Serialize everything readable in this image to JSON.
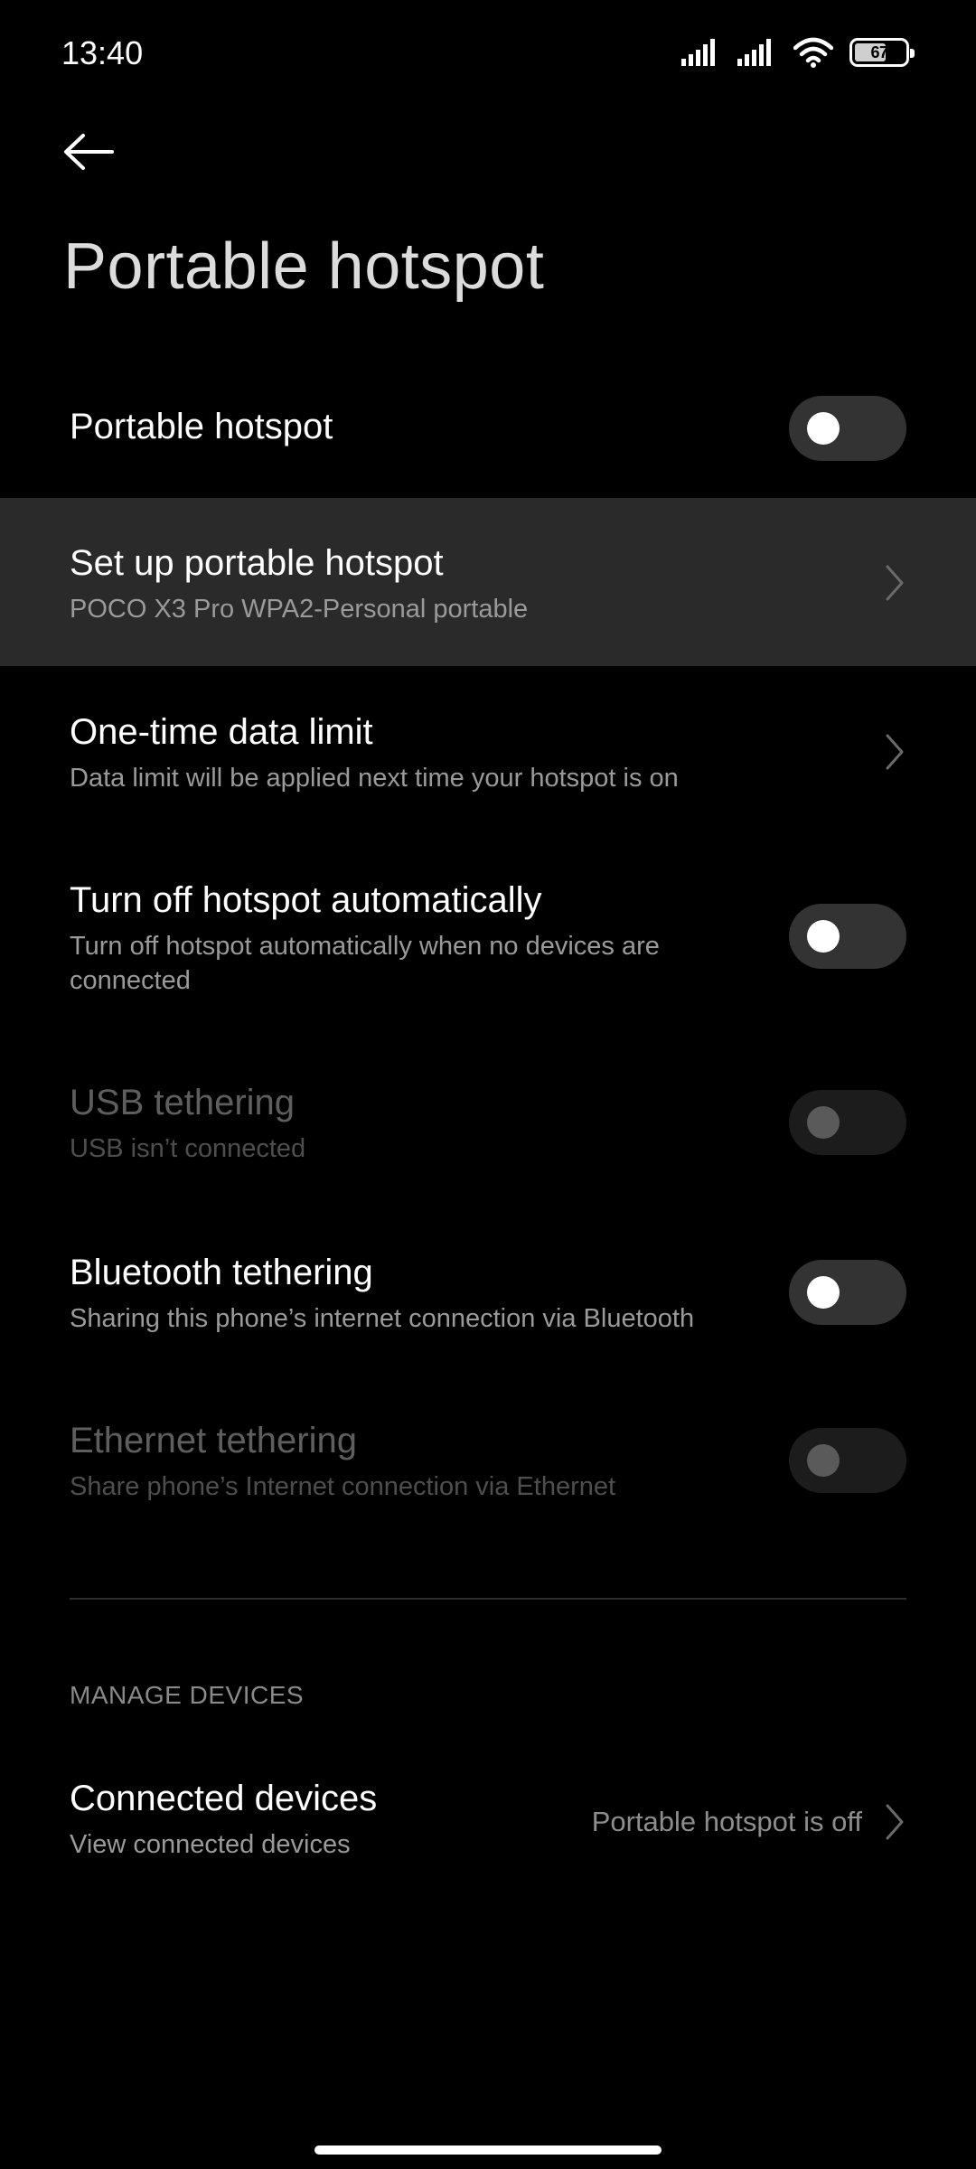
{
  "status_bar": {
    "time": "13:40",
    "battery_text": "67",
    "battery_level": 0.67,
    "icons": [
      "signal-icon",
      "signal-icon",
      "wifi-icon",
      "battery-icon"
    ]
  },
  "header": {
    "back_icon": "arrow-left-icon",
    "title": "Portable hotspot"
  },
  "settings": {
    "portable_hotspot": {
      "title": "Portable hotspot",
      "enabled": false
    },
    "setup": {
      "title": "Set up portable hotspot",
      "subtitle": "POCO X3 Pro WPA2-Personal portable"
    },
    "data_limit": {
      "title": "One-time data limit",
      "subtitle": "Data limit will be applied next time your hotspot is on"
    },
    "auto_off": {
      "title": "Turn off hotspot automatically",
      "subtitle": "Turn off hotspot automatically when no devices are connected",
      "enabled": false
    },
    "usb": {
      "title": "USB tethering",
      "subtitle": "USB isn’t connected",
      "enabled": false,
      "disabled": true
    },
    "bluetooth": {
      "title": "Bluetooth tethering",
      "subtitle": "Sharing this phone’s internet connection via Bluetooth",
      "enabled": false
    },
    "ethernet": {
      "title": "Ethernet tethering",
      "subtitle": "Share phone’s Internet connection via Ethernet",
      "enabled": false,
      "disabled": true
    }
  },
  "manage_devices": {
    "section_title": "MANAGE DEVICES",
    "connected": {
      "title": "Connected devices",
      "subtitle": "View connected devices",
      "value": "Portable hotspot is off"
    }
  },
  "colors": {
    "background": "#000000",
    "highlight_row": "#2a2a2a",
    "toggle_off": "#333333",
    "secondary_text": "#9a9a9a"
  }
}
